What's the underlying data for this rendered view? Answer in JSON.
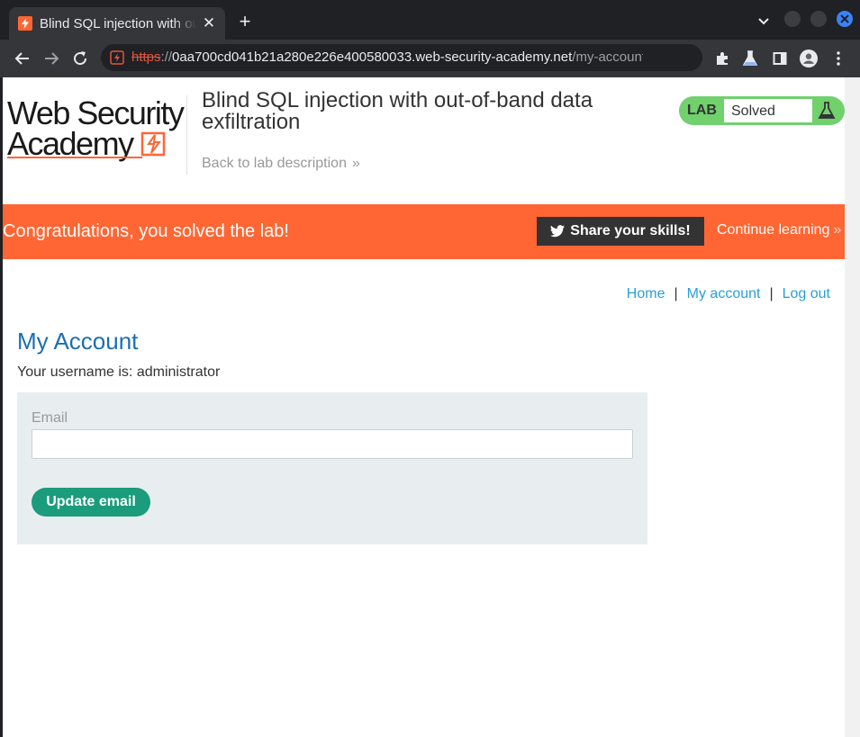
{
  "browser": {
    "tab_title": "Blind SQL injection with out-of-band data exfiltration",
    "url_scheme": "https",
    "url_sep": "://",
    "url_host": "0aa700cd041b21a280e226e400580033.web-security-academy.net",
    "url_path": "/my-account?..."
  },
  "header": {
    "logo_line1": "Web Security",
    "logo_line2": "Academy",
    "lab_title": "Blind SQL injection with out-of-band data exfiltration",
    "back_link": "Back to lab description",
    "badge_label": "LAB",
    "badge_status": "Solved"
  },
  "banner": {
    "message": "Congratulations, you solved the lab!",
    "share_label": "Share your skills!",
    "continue_label": "Continue learning"
  },
  "nav": {
    "home": "Home",
    "my_account": "My account",
    "logout": "Log out",
    "separator": "|"
  },
  "account": {
    "heading": "My Account",
    "username_line": "Your username is: administrator",
    "email_label": "Email",
    "email_value": "",
    "update_label": "Update email"
  },
  "colors": {
    "accent_orange": "#ff6633",
    "badge_green": "#70d16d",
    "link_blue": "#29a0d6",
    "button_teal": "#1b9c7c"
  }
}
